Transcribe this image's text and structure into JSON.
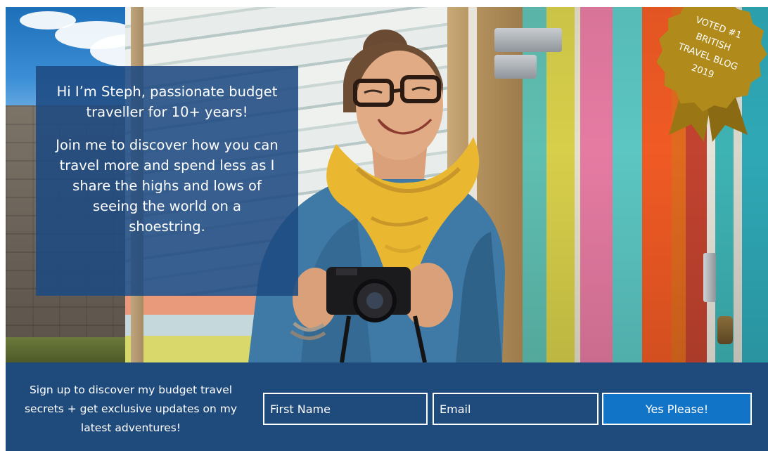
{
  "hero": {
    "intro_line_1": "Hi I’m Steph, passionate budget traveller for 10+ years!",
    "intro_line_2": "Join me to discover how you can travel more and spend less as I share the highs and lows of seeing the world on a shoestring."
  },
  "badge": {
    "line_1": "VOTED #1",
    "line_2": "BRITISH",
    "line_3": "TRAVEL BLOG",
    "line_4": "2019",
    "color": "#b08a1a"
  },
  "signup": {
    "text": "Sign up to discover my budget travel secrets + get exclusive updates on my latest adventures!",
    "first_name_placeholder": "First Name",
    "email_placeholder": "Email",
    "submit_label": "Yes Please!"
  },
  "colors": {
    "panel_blue": "#1f4a7c",
    "button_blue": "#1274c6"
  }
}
